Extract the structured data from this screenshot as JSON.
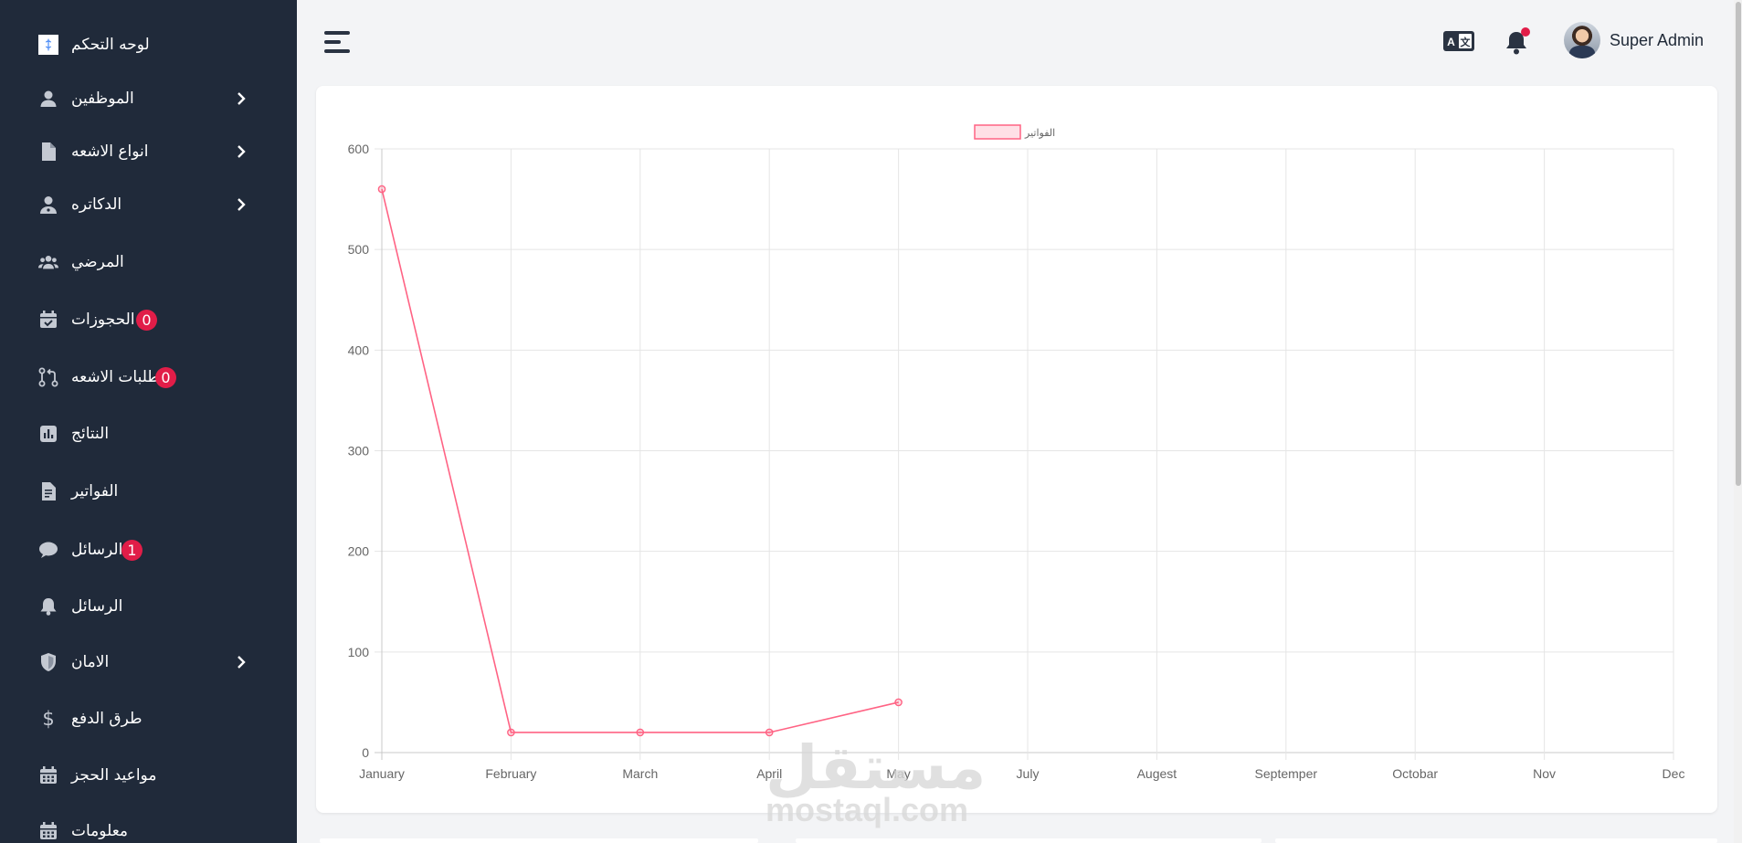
{
  "sidebar": {
    "items": [
      {
        "label": "لوحه التحكم",
        "icon": "logo-icon",
        "chevron": false
      },
      {
        "label": "الموظفين",
        "icon": "user-icon",
        "chevron": true
      },
      {
        "label": "انواع الاشعه",
        "icon": "file-icon",
        "chevron": true
      },
      {
        "label": "الدكاتره",
        "icon": "doctor-icon",
        "chevron": true
      },
      {
        "label": "المرضي",
        "icon": "users-icon",
        "chevron": false
      },
      {
        "label": "الحجوزات",
        "icon": "calendar-check-icon",
        "chevron": false,
        "badge": "0"
      },
      {
        "label": "طلبات الاشعه",
        "icon": "git-pull-request-icon",
        "chevron": false,
        "badge": "0"
      },
      {
        "label": "النتائج",
        "icon": "chart-square-icon",
        "chevron": false
      },
      {
        "label": "الفواتير",
        "icon": "invoice-icon",
        "chevron": false
      },
      {
        "label": "الرسائل",
        "icon": "chat-icon",
        "chevron": false,
        "badge": "1"
      },
      {
        "label": "الرسائل",
        "icon": "bell-icon",
        "chevron": false
      },
      {
        "label": "الامان",
        "icon": "shield-icon",
        "chevron": true
      },
      {
        "label": "طرق الدفع",
        "icon": "dollar-icon",
        "chevron": false
      },
      {
        "label": "مواعيد الحجز",
        "icon": "calendar-icon",
        "chevron": false
      },
      {
        "label": "معلومات",
        "icon": "calendar-icon",
        "chevron": false
      }
    ]
  },
  "topbar": {
    "user_name": "Super Admin",
    "notification_dot": true
  },
  "watermark": {
    "text_ar": "مستقل",
    "text_en": "mostaql.com"
  },
  "colors": {
    "sidebar_bg": "#202a3a",
    "line": "#ff6384",
    "badge": "#e11d48"
  },
  "chart_data": {
    "type": "line",
    "legend": [
      "الفواتير"
    ],
    "legend_position": "top",
    "categories": [
      "January",
      "February",
      "March",
      "April",
      "May",
      "July",
      "Augest",
      "Septemper",
      "Octobar",
      "Nov",
      "Dec"
    ],
    "series": [
      {
        "name": "الفواتير",
        "values": [
          560,
          20,
          20,
          20,
          50,
          null,
          null,
          null,
          null,
          null,
          null
        ]
      }
    ],
    "yticks": [
      "0",
      "100",
      "200",
      "300",
      "400",
      "500",
      "600"
    ],
    "ylim": [
      0,
      600
    ],
    "grid": true
  }
}
